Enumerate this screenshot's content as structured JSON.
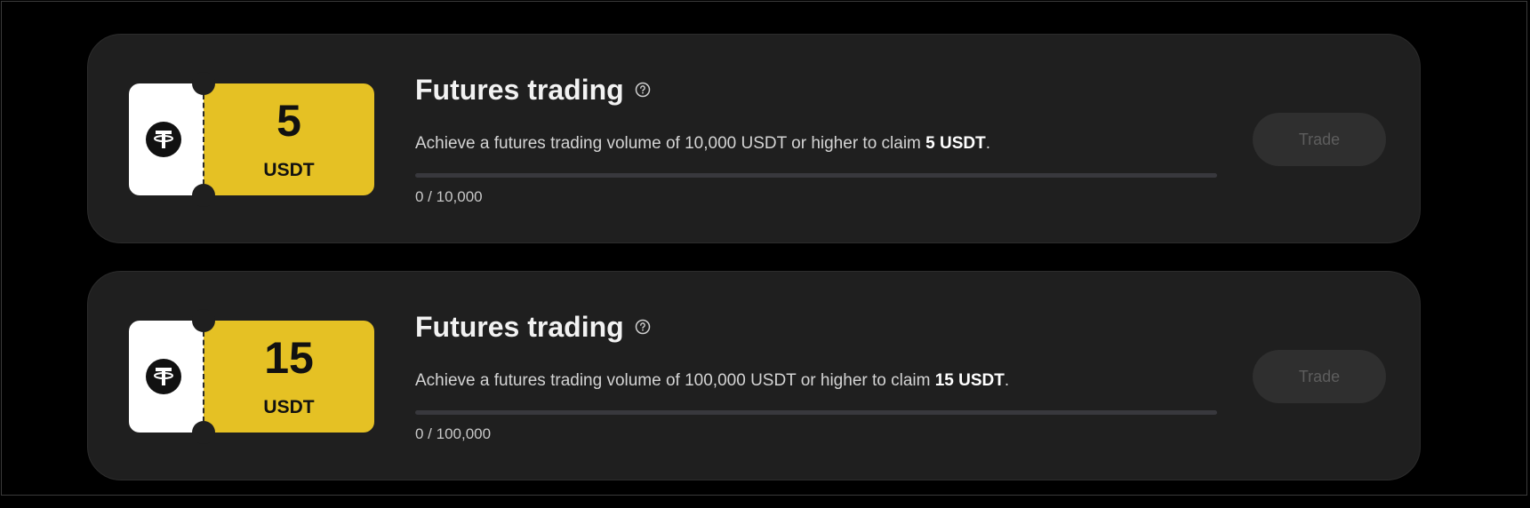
{
  "tasks": [
    {
      "coupon": {
        "amount": "5",
        "unit": "USDT",
        "icon": "tether-icon"
      },
      "title": "Futures trading",
      "description_prefix": "Achieve a futures trading volume of 10,000 USDT or higher to claim ",
      "reward": "5 USDT",
      "description_suffix": ".",
      "progress_text": "0 / 10,000",
      "progress_fraction": 0,
      "button_label": "Trade",
      "button_state": "disabled"
    },
    {
      "coupon": {
        "amount": "15",
        "unit": "USDT",
        "icon": "tether-icon"
      },
      "title": "Futures trading",
      "description_prefix": "Achieve a futures trading volume of 100,000 USDT or higher to claim ",
      "reward": "15 USDT",
      "description_suffix": ".",
      "progress_text": "0 / 100,000",
      "progress_fraction": 0,
      "button_label": "Trade",
      "button_state": "disabled"
    }
  ],
  "colors": {
    "page_background": "#000000",
    "card_background": "#1f1f1f",
    "coupon_accent": "#e5c124",
    "coupon_stub": "#ffffff",
    "button_background": "#2f2f2f",
    "button_text": "#5d5d5d"
  }
}
